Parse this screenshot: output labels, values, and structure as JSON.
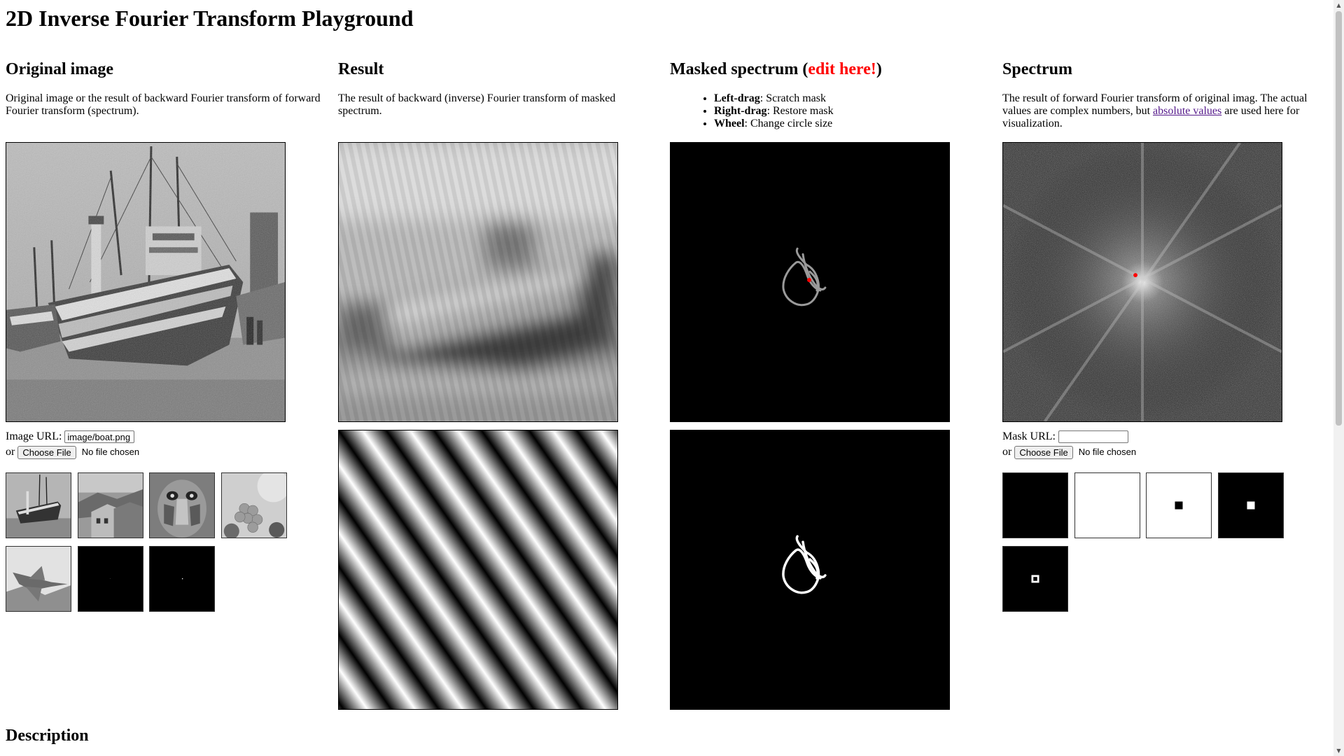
{
  "page": {
    "title": "2D Inverse Fourier Transform Playground",
    "bottom_heading": "Description"
  },
  "columns": {
    "original": {
      "heading": "Original image",
      "description": "Original image or the result of backward Fourier transform of forward Fourier transform (spectrum)."
    },
    "result": {
      "heading": "Result",
      "description": "The result of backward (inverse) Fourier transform of masked spectrum."
    },
    "masked": {
      "heading_prefix": "Masked spectrum (",
      "heading_highlight": "edit here!",
      "heading_suffix": ")",
      "help": [
        {
          "key": "Left-drag",
          "text": ": Scratch mask"
        },
        {
          "key": "Right-drag",
          "text": ": Restore mask"
        },
        {
          "key": "Wheel",
          "text": ": Change circle size"
        }
      ]
    },
    "spectrum": {
      "heading": "Spectrum",
      "description_before": "The result of forward Fourier transform of original imag. The actual values are complex numbers, but ",
      "description_link": "absolute values",
      "description_after": " are used here for visualization."
    }
  },
  "image_input": {
    "label": "Image URL:",
    "value": "image/boat.png",
    "or_label": "or",
    "file_button": "Choose File",
    "file_status": "No file chosen"
  },
  "mask_input": {
    "label": "Mask URL:",
    "value": "",
    "or_label": "or",
    "file_button": "Choose File",
    "file_status": "No file chosen"
  },
  "image_presets": [
    "boat",
    "houses",
    "baboon",
    "fruits",
    "jet",
    "black-dot",
    "single-dot"
  ],
  "mask_presets": [
    "all-black",
    "all-white",
    "white-center-square",
    "black-center-square",
    "black-hollow-square"
  ],
  "colors": {
    "highlight": "#ff0000",
    "link": "#551a8b",
    "spectrum_center_dot": "#ff0000"
  }
}
